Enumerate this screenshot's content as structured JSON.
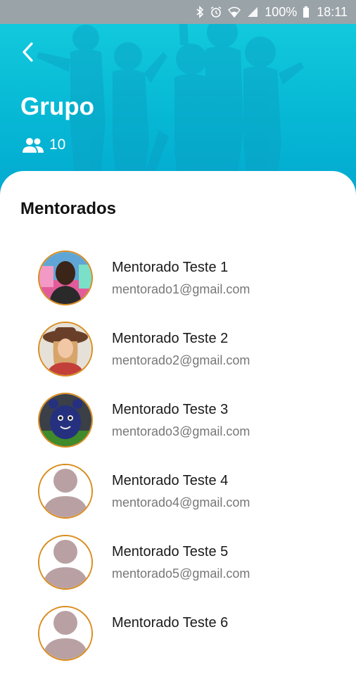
{
  "status_bar": {
    "battery": "100%",
    "time": "18:11",
    "icons": [
      "bluetooth-icon",
      "alarm-icon",
      "wifi-icon",
      "signal-icon",
      "battery-icon"
    ]
  },
  "header": {
    "back_icon": "chevron-left-icon",
    "title": "Grupo",
    "members_icon": "people-icon",
    "member_count": "10"
  },
  "section": {
    "title": "Mentorados"
  },
  "mentees": [
    {
      "name": "Mentorado Teste 1",
      "email": "mentorado1@gmail.com",
      "avatar": "photo-man"
    },
    {
      "name": "Mentorado Teste 2",
      "email": "mentorado2@gmail.com",
      "avatar": "photo-woman-hat"
    },
    {
      "name": "Mentorado Teste 3",
      "email": "mentorado3@gmail.com",
      "avatar": "photo-toy"
    },
    {
      "name": "Mentorado Teste 4",
      "email": "mentorado4@gmail.com",
      "avatar": "default-user"
    },
    {
      "name": "Mentorado Teste 5",
      "email": "mentorado5@gmail.com",
      "avatar": "default-user"
    },
    {
      "name": "Mentorado Teste 6",
      "email": "",
      "avatar": "default-user"
    }
  ],
  "colors": {
    "header_teal": "#06b7d4",
    "avatar_border": "#d98c1e",
    "default_avatar": "#b9a1a3"
  }
}
